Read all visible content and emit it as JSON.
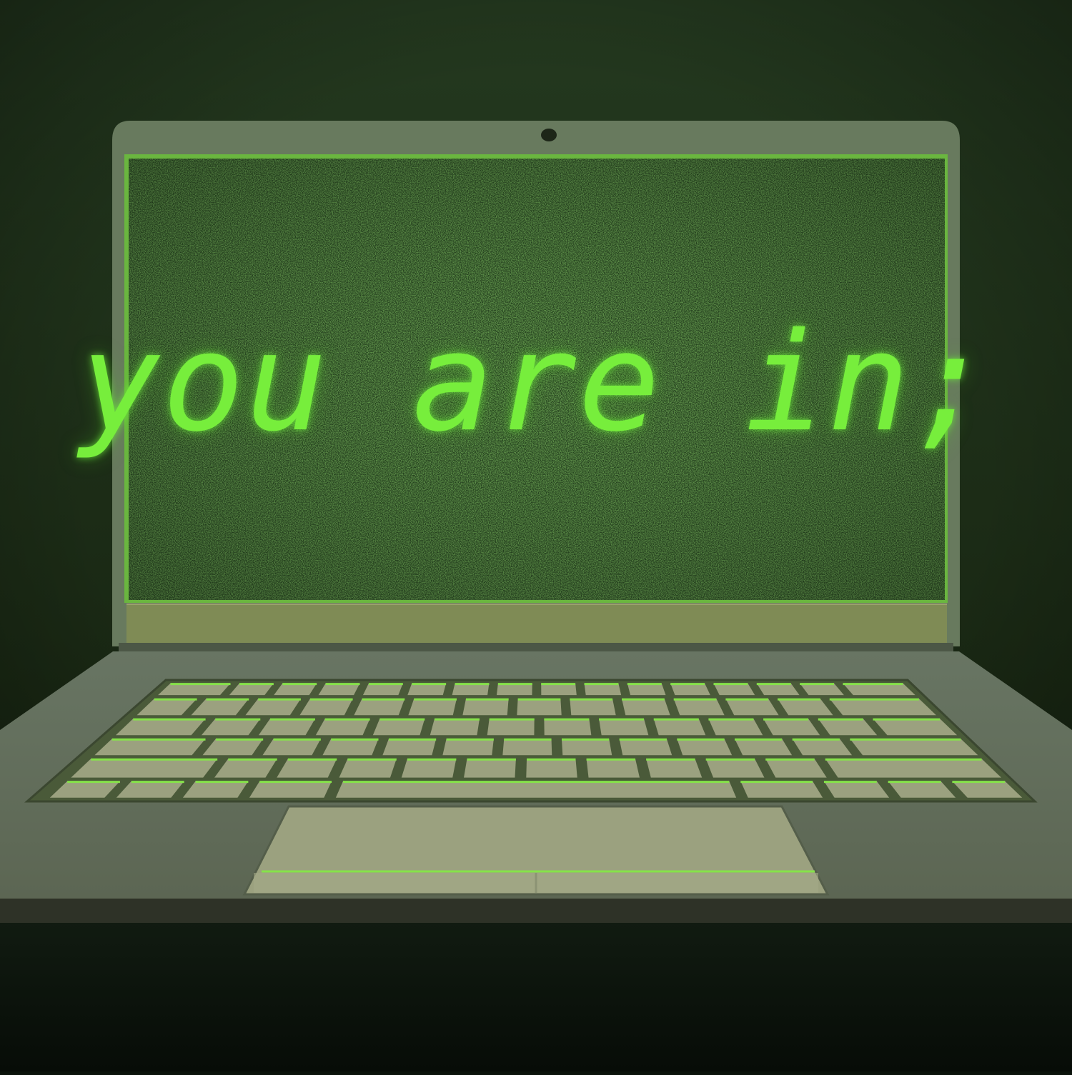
{
  "screen": {
    "message": "you are in;"
  },
  "colors": {
    "background": "#1f361d",
    "laptop_body": "#687a5e",
    "screen_bg": "#24401e",
    "screen_border": "#6ab63f",
    "chin": "#7f8b55",
    "deck": "#5f6a55",
    "keys": "#9ba17f",
    "key_glow": "#86e24a",
    "text_glow": "#77ee3c",
    "table": "#0b130b"
  },
  "icons": {
    "webcam": "webcam-icon"
  }
}
